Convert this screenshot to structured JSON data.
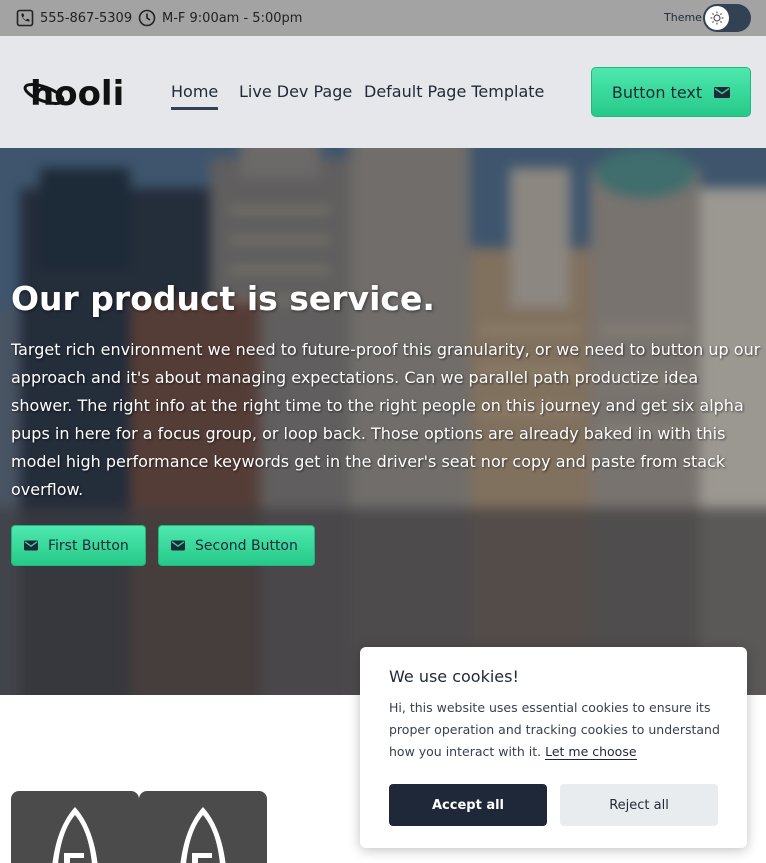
{
  "topbar": {
    "phone": "555-867-5309",
    "hours": "M-F 9:00am - 5:00pm",
    "theme_label": "Theme"
  },
  "header": {
    "logo_text": "hooli",
    "nav": [
      {
        "label": "Home",
        "active": true
      },
      {
        "label": "Live Dev Page",
        "active": false
      },
      {
        "label": "Default Page Template",
        "active": false
      }
    ],
    "cta_label": "Button text"
  },
  "hero": {
    "title": "Our product is service.",
    "body": "Target rich environment we need to future-proof this granularity, or we need to button up our approach and it's about managing expectations. Can we parallel path productize idea shower. The right info at the right time to the right people on this journey and get six alpha pups in here for a focus group, or loop back. Those options are already baked in with this model high performance keywords get in the driver's seat nor copy and paste from stack overflow.",
    "buttons": [
      {
        "label": "First Button",
        "icon": "envelope-icon"
      },
      {
        "label": "Second Button",
        "icon": "envelope-icon"
      }
    ]
  },
  "cookie_banner": {
    "title": "We use cookies!",
    "text": "Hi, this website uses essential cookies to ensure its proper operation and tracking cookies to understand how you interact with it.",
    "link_label": "Let me choose",
    "accept_label": "Accept all",
    "reject_label": "Reject all"
  },
  "colors": {
    "accent_green": "#34d399",
    "topbar_bg": "#a3a3a3",
    "header_bg": "#e5e7eb",
    "dark_button": "#1e2838"
  }
}
